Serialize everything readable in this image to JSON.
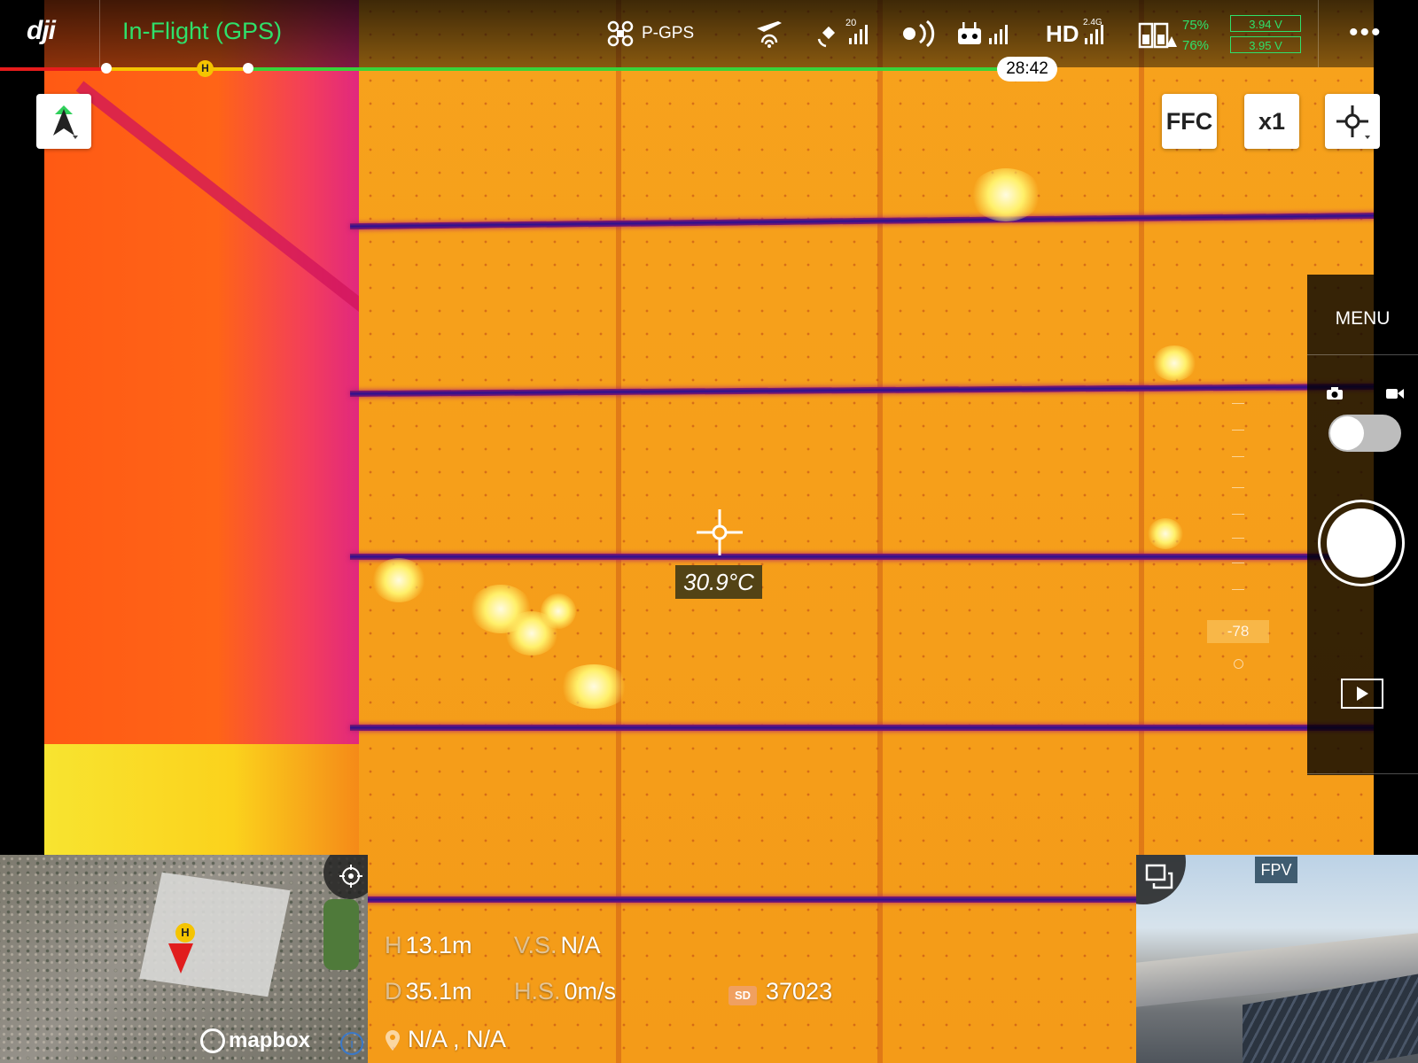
{
  "app": {
    "logo_text": "dji"
  },
  "status_bar": {
    "flight_status": "In-Flight (GPS)",
    "flight_mode": "P-GPS",
    "gps_satellite_count": "20",
    "hd_band": "2.4G",
    "hd_label": "HD",
    "battery": {
      "percent_1": "75%",
      "percent_2": "76%",
      "voltage_1": "3.94 V",
      "voltage_2": "3.95 V"
    },
    "flight_time": "28:42",
    "home_marker": "H",
    "colors": {
      "ok": "#2fe06a",
      "progress_red": "#e81c1c",
      "progress_yellow": "#f5c400",
      "progress_green": "#39d33a"
    }
  },
  "camera_controls": {
    "ffc_label": "FFC",
    "zoom_label": "x1"
  },
  "center": {
    "spot_temperature": "30.9°C"
  },
  "right_panel": {
    "menu_label": "MENU",
    "exposure_value": "-78"
  },
  "telemetry": {
    "h_key": "H",
    "h_value": "13.1m",
    "vs_key": "V.S.",
    "vs_value": "N/A",
    "d_key": "D",
    "d_value": "35.1m",
    "hs_key": "H.S.",
    "hs_value": "0m/s",
    "sd_icon": "SD",
    "sd_remaining": "37023",
    "location": "N/A , N/A"
  },
  "map": {
    "attribution": "mapbox",
    "home_marker": "H",
    "info_symbol": "i"
  },
  "fpv": {
    "label": "FPV"
  }
}
